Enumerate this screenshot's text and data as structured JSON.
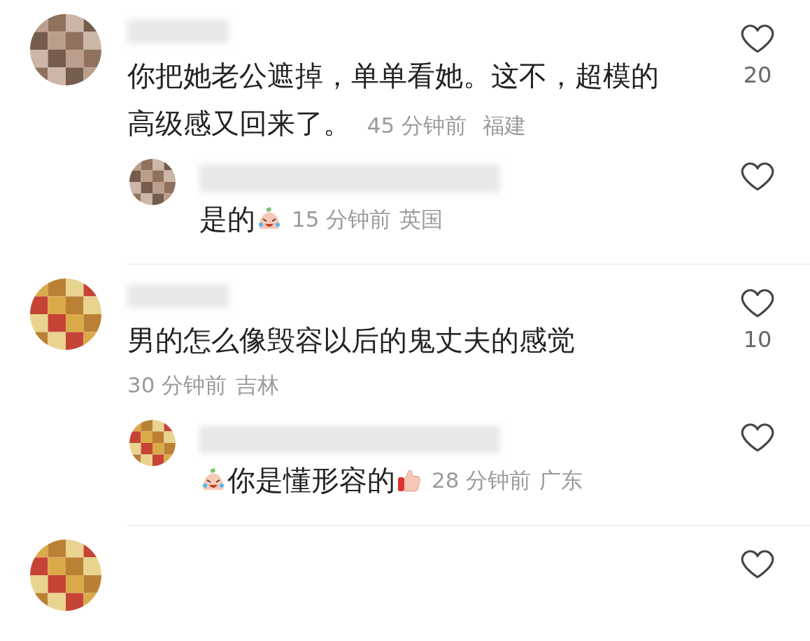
{
  "comments": [
    {
      "likes": "20",
      "parts": [
        {
          "kind": "text",
          "text": "你把她老公遮掉，单单看她。这不，超模的"
        },
        {
          "kind": "text",
          "text": "高级感又回来了。"
        }
      ],
      "time": "45 分钟前",
      "location": "福建",
      "meta_inline": true,
      "replies": [
        {
          "parts": [
            {
              "kind": "text",
              "text": "是的"
            },
            {
              "kind": "crying-face"
            }
          ],
          "time": "15 分钟前",
          "location": "英国"
        }
      ]
    },
    {
      "likes": "10",
      "parts": [
        {
          "kind": "text",
          "text": "男的怎么像毁容以后的鬼丈夫的感觉"
        }
      ],
      "time": "30 分钟前",
      "location": "吉林",
      "meta_inline": false,
      "replies": [
        {
          "parts": [
            {
              "kind": "crying-face"
            },
            {
              "kind": "text",
              "text": "你是懂形容的"
            },
            {
              "kind": "thumbs-up"
            }
          ],
          "time": "28 分钟前",
          "location": "广东"
        }
      ]
    }
  ]
}
